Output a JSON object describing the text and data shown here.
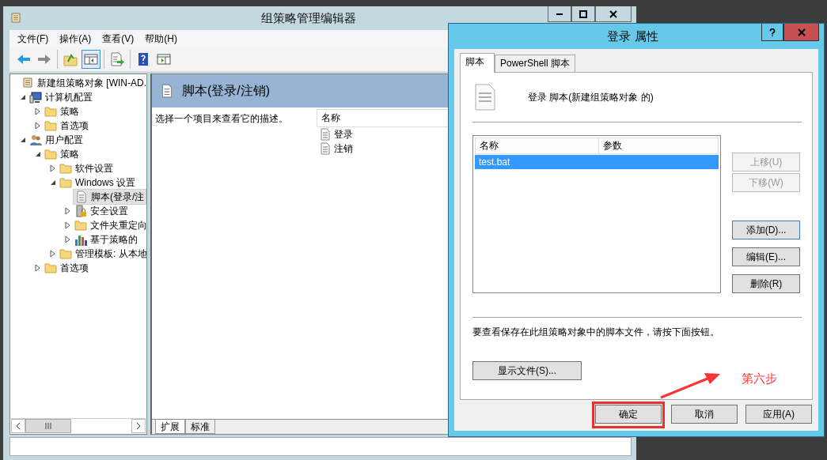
{
  "main_window": {
    "title": "组策略管理编辑器",
    "menu": [
      "文件(F)",
      "操作(A)",
      "查看(V)",
      "帮助(H)"
    ],
    "toolbar": [
      {
        "buttons": [
          {
            "kind": "back",
            "pressed": false
          },
          {
            "kind": "forward",
            "pressed": false
          }
        ]
      },
      {
        "buttons": [
          {
            "kind": "up",
            "pressed": false
          },
          {
            "kind": "tree-toggle",
            "pressed": true
          }
        ]
      },
      {
        "buttons": [
          {
            "kind": "export",
            "pressed": false
          }
        ]
      },
      {
        "buttons": [
          {
            "kind": "help",
            "pressed": false
          },
          {
            "kind": "pane-toggle",
            "pressed": false
          }
        ]
      }
    ],
    "tree": [
      {
        "label": "新建组策略对象 [WIN-AD.",
        "kind": "policy",
        "selected": false,
        "children": [
          {
            "label": "计算机配置",
            "kind": "computer",
            "expanded": true,
            "selected": false,
            "children": [
              {
                "label": "策略",
                "kind": "folder",
                "expanded": false,
                "selected": false
              },
              {
                "label": "首选项",
                "kind": "folder",
                "expanded": false,
                "selected": false
              }
            ]
          },
          {
            "label": "用户配置",
            "kind": "users",
            "expanded": true,
            "selected": false,
            "children": [
              {
                "label": "策略",
                "kind": "folder",
                "expanded": true,
                "selected": false,
                "children": [
                  {
                    "label": "软件设置",
                    "kind": "folder",
                    "expanded": false,
                    "selected": false
                  },
                  {
                    "label": "Windows 设置",
                    "kind": "folder",
                    "expanded": true,
                    "selected": false,
                    "children": [
                      {
                        "label": "脚本(登录/注",
                        "kind": "script",
                        "selected": true
                      },
                      {
                        "label": "安全设置",
                        "kind": "security",
                        "expanded": false,
                        "selected": false
                      },
                      {
                        "label": "文件夹重定向",
                        "kind": "folder",
                        "expanded": false,
                        "selected": false
                      },
                      {
                        "label": "基于策略的",
                        "kind": "chart",
                        "expanded": false,
                        "selected": false
                      }
                    ]
                  },
                  {
                    "label": "管理模板: 从本地",
                    "kind": "folder",
                    "expanded": false,
                    "selected": false
                  }
                ]
              },
              {
                "label": "首选项",
                "kind": "folder",
                "expanded": false,
                "selected": false
              }
            ]
          }
        ]
      }
    ],
    "details": {
      "title": "脚本(登录/注销)",
      "description": "选择一个项目来查看它的描述。",
      "column": "名称",
      "items": [
        "登录",
        "注销"
      ],
      "tabs": [
        {
          "label": "扩展",
          "selected": true
        },
        {
          "label": "标准",
          "selected": false
        }
      ]
    }
  },
  "dialog": {
    "title": "登录 属性",
    "tabs": [
      {
        "label": "脚本",
        "selected": true
      },
      {
        "label": "PowerShell 脚本",
        "selected": false
      }
    ],
    "heading": "登录 脚本(新建组策略对象 的)",
    "columns": [
      "名称",
      "参数"
    ],
    "rows": [
      {
        "cells": [
          "test.bat"
        ],
        "selected": true
      }
    ],
    "side_buttons": [
      {
        "label": "上移(U)",
        "disabled": true,
        "focused": false
      },
      {
        "label": "下移(W)",
        "disabled": true,
        "focused": false
      },
      {
        "label": "添加(D)...",
        "disabled": false,
        "focused": true
      },
      {
        "label": "编辑(E)...",
        "disabled": false,
        "focused": false
      },
      {
        "label": "删除(R)",
        "disabled": false,
        "focused": false
      }
    ],
    "note": "要查看保存在此组策略对象中的脚本文件，请按下面按钮。",
    "show_files": "显示文件(S)...",
    "buttons": [
      {
        "label": "确定",
        "highlighted": true
      },
      {
        "label": "取消",
        "highlighted": false
      },
      {
        "label": "应用(A)",
        "highlighted": false
      }
    ]
  },
  "annotation": {
    "label": "第六步"
  }
}
